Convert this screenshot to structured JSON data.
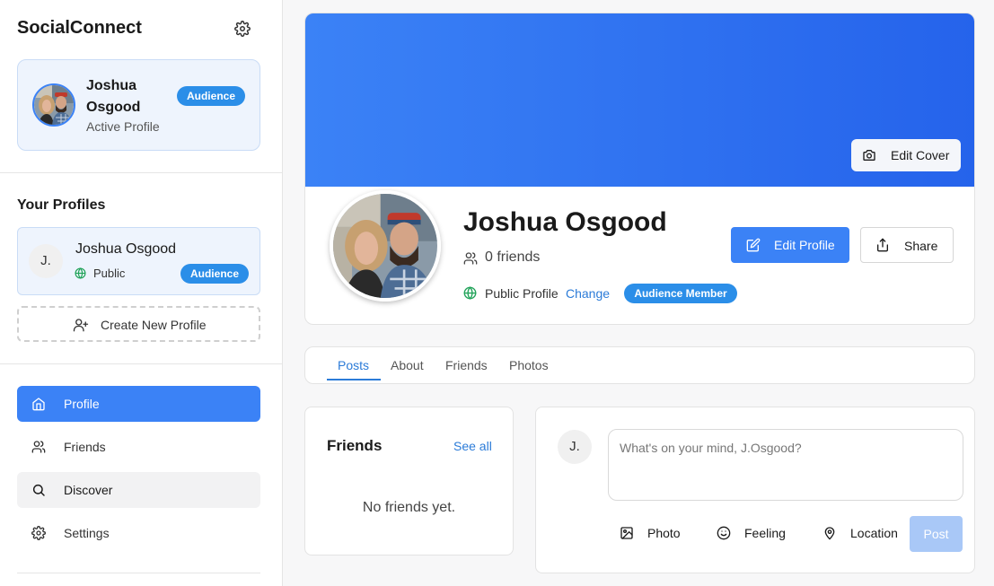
{
  "app": {
    "brand": "SocialConnect"
  },
  "active_profile": {
    "name": "Joshua Osgood",
    "status": "Active Profile",
    "badge": "Audience"
  },
  "profiles_section": {
    "title": "Your Profiles",
    "items": [
      {
        "initial": "J.",
        "name": "Joshua Osgood",
        "visibility": "Public",
        "badge": "Audience"
      }
    ],
    "create_label": "Create New Profile"
  },
  "nav": {
    "items": [
      {
        "label": "Profile",
        "icon": "home-icon",
        "active": true
      },
      {
        "label": "Friends",
        "icon": "users-icon"
      },
      {
        "label": "Discover",
        "icon": "search-icon"
      },
      {
        "label": "Settings",
        "icon": "gear-icon"
      }
    ]
  },
  "profile": {
    "name": "Joshua Osgood",
    "friends_count": "0 friends",
    "visibility": "Public Profile",
    "change_label": "Change",
    "member_badge": "Audience Member",
    "edit_cover_label": "Edit Cover",
    "edit_profile_label": "Edit Profile",
    "share_label": "Share"
  },
  "tabs": [
    {
      "label": "Posts",
      "active": true
    },
    {
      "label": "About"
    },
    {
      "label": "Friends"
    },
    {
      "label": "Photos"
    }
  ],
  "friends_panel": {
    "title": "Friends",
    "see_all": "See all",
    "empty": "No friends yet."
  },
  "composer": {
    "initial": "J.",
    "placeholder": "What's on your mind, J.Osgood?",
    "actions": [
      {
        "label": "Photo",
        "icon": "image-icon"
      },
      {
        "label": "Feeling",
        "icon": "smile-icon"
      },
      {
        "label": "Location",
        "icon": "map-pin-icon"
      }
    ],
    "post_label": "Post"
  },
  "colors": {
    "accent": "#3b82f6",
    "badge": "#2b8ee8",
    "link": "#2b7bd8",
    "cover_start": "#3b82f6",
    "cover_end": "#2563eb"
  }
}
